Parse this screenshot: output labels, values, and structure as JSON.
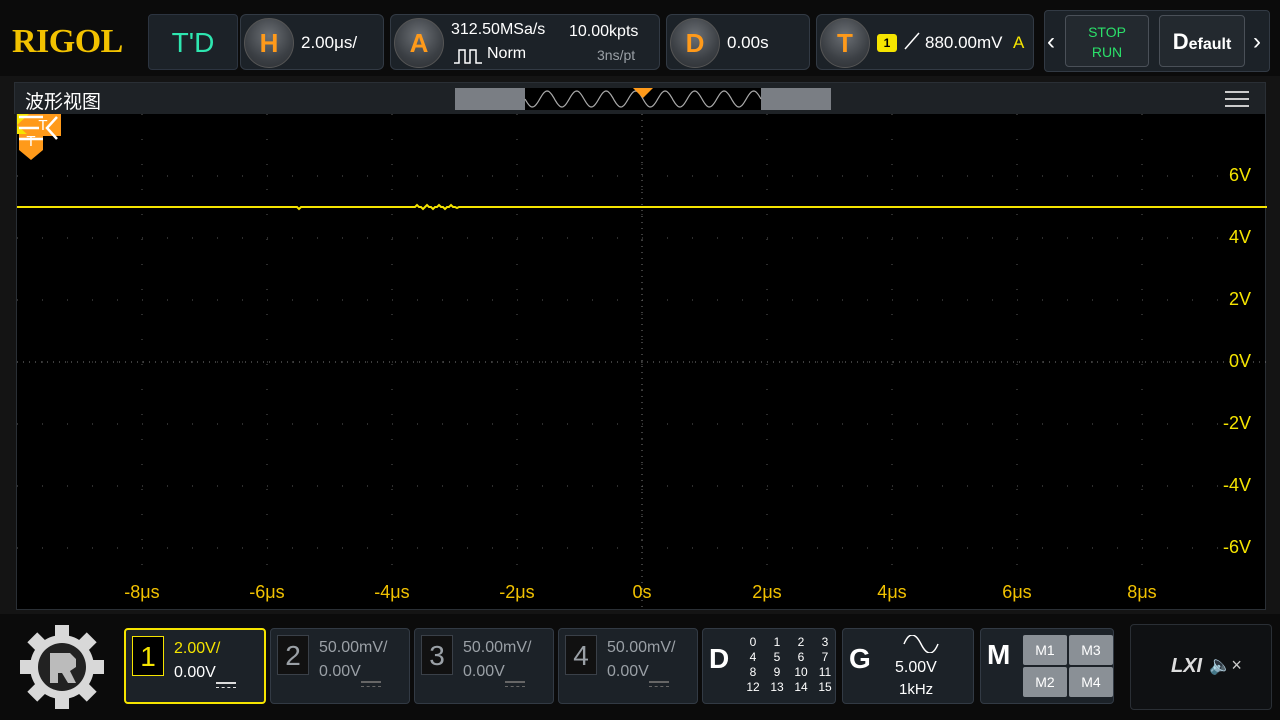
{
  "header": {
    "logo": "RIGOL",
    "mode": "T'D",
    "horizontal": {
      "letter": "H",
      "timebase": "2.00μs/"
    },
    "acquire": {
      "letter": "A",
      "sample_rate": "312.50MSa/s",
      "memory_depth": "10.00kpts",
      "mode": "Norm",
      "resolution": "3ns/pt"
    },
    "delay": {
      "letter": "D",
      "value": "0.00s"
    },
    "trigger": {
      "letter": "T",
      "source_badge": "1",
      "level": "880.00mV",
      "source_letter": "A"
    },
    "stop_label": "STOP",
    "run_label": "RUN",
    "default_letter": "D",
    "default_label": "efault"
  },
  "panel": {
    "title": "波形视图",
    "trigger_marker": "T",
    "ch1_marker": "1",
    "y_labels": [
      "6V",
      "4V",
      "2V",
      "0V",
      "-2V",
      "-4V",
      "-6V"
    ],
    "x_labels": [
      "-8μs",
      "-6μs",
      "-4μs",
      "-2μs",
      "0s",
      "2μs",
      "4μs",
      "6μs",
      "8μs"
    ],
    "trace_level_v": 5.0
  },
  "channels": [
    {
      "num": "1",
      "scale": "2.00V/",
      "offset": "0.00V"
    },
    {
      "num": "2",
      "scale": "50.00mV/",
      "offset": "0.00V"
    },
    {
      "num": "3",
      "scale": "50.00mV/",
      "offset": "0.00V"
    },
    {
      "num": "4",
      "scale": "50.00mV/",
      "offset": "0.00V"
    }
  ],
  "digital": {
    "letter": "D",
    "bits": [
      "0",
      "1",
      "2",
      "3",
      "4",
      "5",
      "6",
      "7",
      "8",
      "9",
      "10",
      "11",
      "12",
      "13",
      "14",
      "15"
    ]
  },
  "generator": {
    "letter": "G",
    "amplitude": "5.00V",
    "frequency": "1kHz"
  },
  "math": {
    "letter": "M",
    "items": [
      "M1",
      "M3",
      "M2",
      "M4"
    ]
  },
  "status": {
    "lxi": "LXI",
    "mute": "🔈×"
  },
  "colors": {
    "ch1": "#f5e400",
    "accent": "#ff9a1a",
    "run": "#2be06a",
    "mode": "#2ee6b0"
  }
}
